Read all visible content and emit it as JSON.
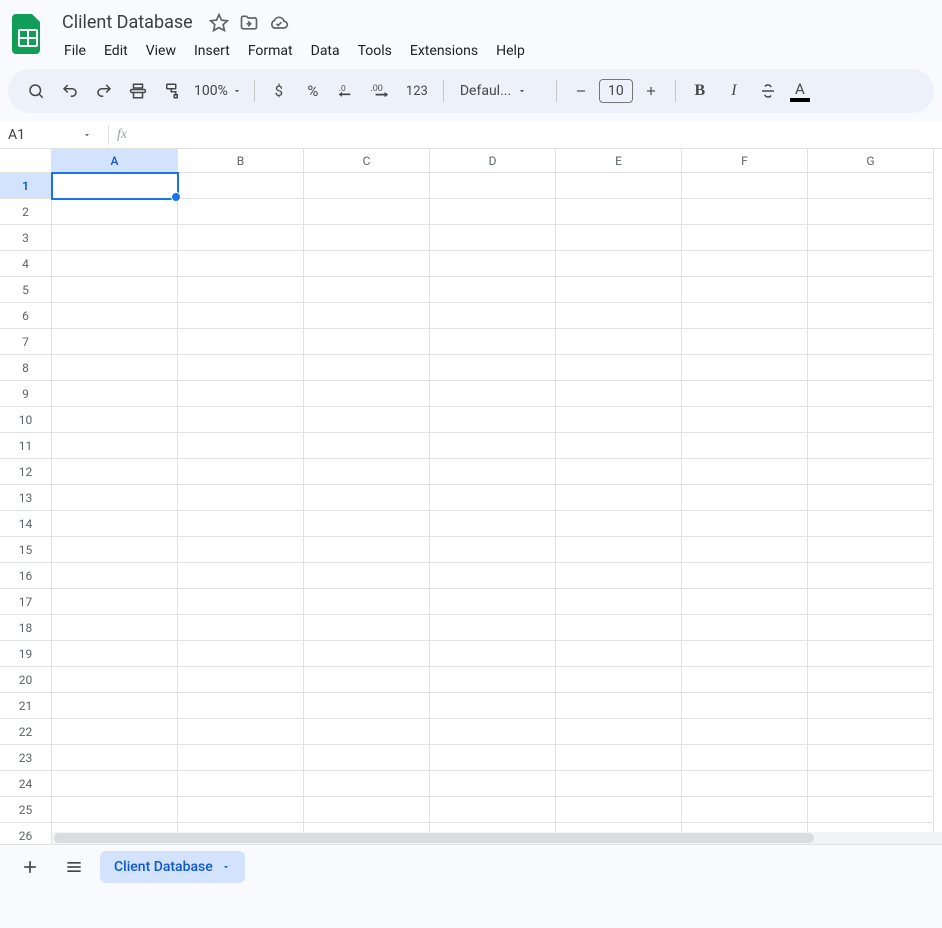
{
  "doc": {
    "title": "Clilent Database"
  },
  "menu": {
    "items": [
      "File",
      "Edit",
      "View",
      "Insert",
      "Format",
      "Data",
      "Tools",
      "Extensions",
      "Help"
    ]
  },
  "toolbar": {
    "zoom": "100%",
    "currency": "$",
    "percent": "%",
    "dec_decrease_tip": "Decrease decimal places",
    "dec_increase_tip": "Increase decimal places",
    "num_format": "123",
    "font": "Defaul...",
    "font_size": "10"
  },
  "name_box": {
    "value": "A1"
  },
  "formula": {
    "label": "fx",
    "value": ""
  },
  "grid": {
    "columns": [
      "A",
      "B",
      "C",
      "D",
      "E",
      "F",
      "G"
    ],
    "rows": [
      1,
      2,
      3,
      4,
      5,
      6,
      7,
      8,
      9,
      10,
      11,
      12,
      13,
      14,
      15,
      16,
      17,
      18,
      19,
      20,
      21,
      22,
      23,
      24,
      25,
      26
    ],
    "active_cell": "A1"
  },
  "sheet_tab": {
    "name": "Client Database"
  }
}
